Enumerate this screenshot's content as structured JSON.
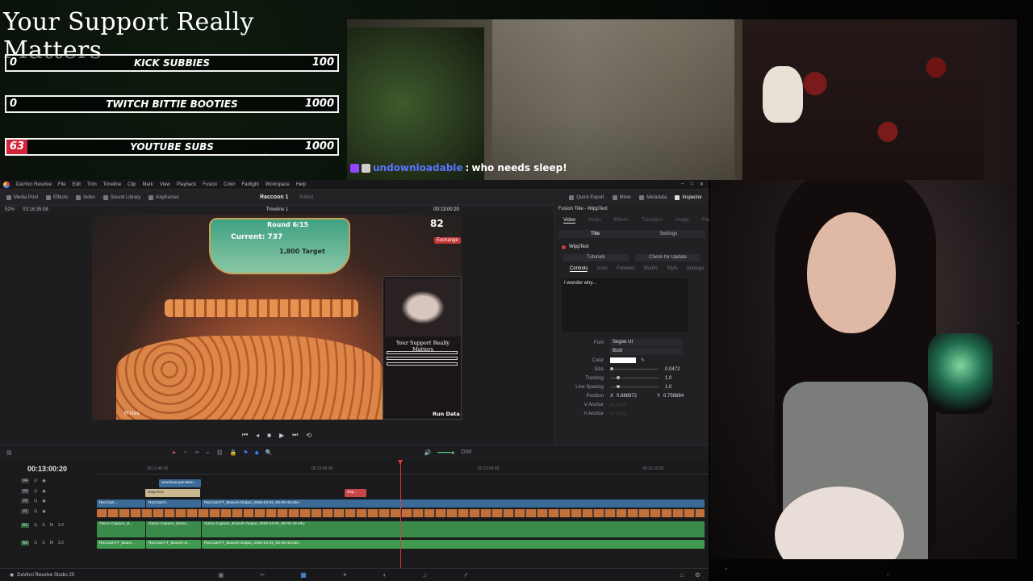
{
  "goals": {
    "title": "Your Support Really Matters",
    "items": [
      {
        "current": "0",
        "name": "KICK SUBBIES",
        "max": "100",
        "fill": 0
      },
      {
        "current": "0",
        "name": "TWITCH BITTIE BOOTIES",
        "max": "1000",
        "fill": 0
      },
      {
        "current": "63",
        "name": "YOUTUBE SUBS",
        "max": "1000",
        "fill": 0.063
      }
    ]
  },
  "chat": {
    "user": "undownloadable",
    "sep": ":",
    "message": "who needs sleep!"
  },
  "resolve": {
    "menu": [
      "DaVinci Resolve",
      "File",
      "Edit",
      "Trim",
      "Timeline",
      "Clip",
      "Mark",
      "View",
      "Playback",
      "Fusion",
      "Color",
      "Fairlight",
      "Workspace",
      "Help"
    ],
    "toolbar_left": [
      "Media Pool",
      "Effects",
      "Index",
      "Sound Library",
      "Keyframes"
    ],
    "project_name": "Raccoon 1",
    "project_status": "Edited",
    "toolbar_right": [
      "Quick Export",
      "Mixer",
      "Metadata",
      "Inspector"
    ],
    "zoom": "52%",
    "source_tc": "03:16:35:08",
    "timeline_name": "Timeline 1",
    "record_tc": "00:13:00:20",
    "viewer": {
      "round": "Round",
      "round_val": "6/15",
      "current": "Current: 737",
      "target_val": "1,800",
      "target": "Target",
      "hud_num": "82",
      "exchange": "Exchange",
      "prizes": "Prizes",
      "rundata": "Run Data",
      "inset_title": "Your Support Really Matters"
    },
    "inspector": {
      "header": "Fusion Title - WippText",
      "tabs": [
        "Video",
        "Audio",
        "Effects",
        "Transition",
        "Image",
        "File"
      ],
      "sub_tabs": [
        "Title",
        "Settings"
      ],
      "tool_name": "WippText",
      "buttons": [
        "Tutorials",
        "Check for Update"
      ],
      "control_tabs": [
        "Controls",
        "Anim",
        "Follower",
        "Modifs",
        "Style",
        "Settings"
      ],
      "text_value": "I wonder why...",
      "font_label": "Font",
      "font_value": "Segoe UI",
      "style_value": "Bold",
      "color_label": "Color",
      "size_label": "Size",
      "size_value": "0.0472",
      "tracking_label": "Tracking",
      "tracking_value": "1.0",
      "linespacing_label": "Line Spacing",
      "linespacing_value": "1.0",
      "position_label": "Position",
      "position_x_label": "X",
      "position_x": "0.886972",
      "position_y_label": "Y",
      "position_y": "0.756684",
      "vanchor_label": "V Anchor",
      "hanchor_label": "H Anchor"
    },
    "timeline": {
      "timecode": "00:13:00:20",
      "ruler": [
        "00:12:48:00",
        "00:12:56:00",
        "00:13:04:00",
        "00:13:12:00"
      ],
      "tracks": [
        "V4",
        "V3",
        "V2",
        "V1",
        "A1",
        "A2"
      ],
      "clips": {
        "v4": "americas-got-talen...",
        "v3": "WippText",
        "v3b": "Wip...",
        "v2a": "RecCam...",
        "v2b": "RecCamY...",
        "v2c": "RecCamYT_Branch-Output_2026-04-02_06-05-43.mkv",
        "a1a": "Game-Capture_B...",
        "a1b": "Game-Capture_Branc...",
        "a1c": "Game-Capture_Branch-Output_2026-04-02_06-05-43.mkv",
        "a2a": "RecCamYT_Branc...",
        "a2b": "RecCamYT_Branch-O...",
        "a2c": "RecCamYT_Branch-Output_2026-04-02_06-05-43.mkv"
      },
      "audio_level": "2.0",
      "dim": "DIM"
    },
    "app_label": "DaVinci Resolve Studio 20"
  }
}
